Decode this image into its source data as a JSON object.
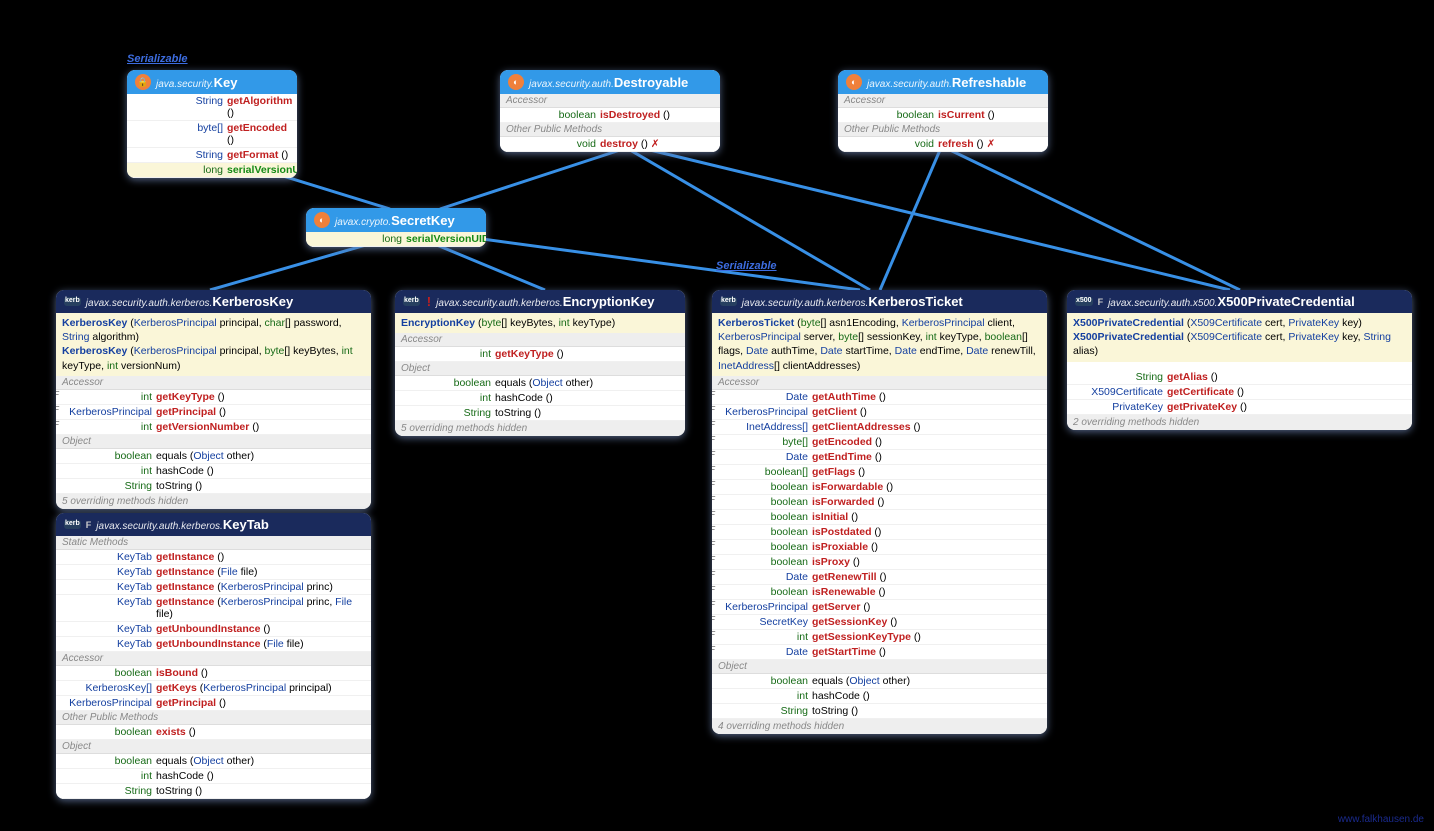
{
  "labels": {
    "serializable": "Serializable",
    "accessor": "Accessor",
    "otherPublic": "Other Public Methods",
    "object": "Object",
    "staticMethods": "Static Methods",
    "watermark": "www.falkhausen.de"
  },
  "key": {
    "pkg": "java.security.",
    "cls": "Key",
    "rows": [
      {
        "ret": "String",
        "name": "getAlgorithm",
        "params": "()"
      },
      {
        "ret": "byte[]",
        "name": "getEncoded",
        "params": "()"
      },
      {
        "ret": "String",
        "name": "getFormat",
        "params": "()"
      }
    ],
    "serial": {
      "ret": "long",
      "name": "serialVersionUID"
    }
  },
  "destroyable": {
    "pkg": "javax.security.auth.",
    "cls": "Destroyable",
    "rows": [
      {
        "ret": "boolean",
        "name": "isDestroyed",
        "params": "()"
      }
    ],
    "other": [
      {
        "ret": "void",
        "name": "destroy",
        "params": "() ",
        "suffix": "✗"
      }
    ]
  },
  "refreshable": {
    "pkg": "javax.security.auth.",
    "cls": "Refreshable",
    "rows": [
      {
        "ret": "boolean",
        "name": "isCurrent",
        "params": "()"
      }
    ],
    "other": [
      {
        "ret": "void",
        "name": "refresh",
        "params": "() ",
        "suffix": "✗"
      }
    ]
  },
  "secretkey": {
    "pkg": "javax.crypto.",
    "cls": "SecretKey",
    "serial": {
      "ret": "long",
      "name": "serialVersionUID"
    }
  },
  "kerbkey": {
    "pkg": "javax.security.auth.kerberos.",
    "cls": "KerberosKey",
    "constructors": [
      "KerberosKey (KerberosPrincipal principal, char[] password, String algorithm)",
      "KerberosKey (KerberosPrincipal principal, byte[] keyBytes, int keyType, int versionNum)"
    ],
    "accessor": [
      {
        "ret": "int",
        "name": "getKeyType",
        "params": "()",
        "flag": "F"
      },
      {
        "ret": "KerberosPrincipal",
        "retBlue": true,
        "name": "getPrincipal",
        "params": "()",
        "flag": "F"
      },
      {
        "ret": "int",
        "name": "getVersionNumber",
        "params": "()",
        "flag": "F"
      }
    ],
    "object": [
      {
        "ret": "boolean",
        "name": "equals",
        "params": "(Object other)",
        "blueName": false,
        "paramBlue": "Object"
      },
      {
        "ret": "int",
        "name": "hashCode",
        "params": "()"
      },
      {
        "ret": "String",
        "name": "toString",
        "params": "()"
      }
    ],
    "hidden": "5 overriding methods hidden"
  },
  "enckey": {
    "pkg": "javax.security.auth.kerberos.",
    "cls": "EncryptionKey",
    "constructors": [
      "EncryptionKey (byte[] keyBytes, int keyType)"
    ],
    "accessor": [
      {
        "ret": "int",
        "name": "getKeyType",
        "params": "()"
      }
    ],
    "object": [
      {
        "ret": "boolean",
        "name": "equals",
        "params": "(Object other)",
        "paramBlue": "Object"
      },
      {
        "ret": "int",
        "name": "hashCode",
        "params": "()"
      },
      {
        "ret": "String",
        "name": "toString",
        "params": "()"
      }
    ],
    "hidden": "5 overriding methods hidden"
  },
  "keytab": {
    "pkg": "javax.security.auth.kerberos.",
    "cls": "KeyTab",
    "static": [
      {
        "ret": "KeyTab",
        "name": "getInstance",
        "params": "()"
      },
      {
        "ret": "KeyTab",
        "name": "getInstance",
        "params": "(File file)",
        "paramBlue": "File"
      },
      {
        "ret": "KeyTab",
        "name": "getInstance",
        "params": "(KerberosPrincipal princ)",
        "paramBlue": "KerberosPrincipal"
      },
      {
        "ret": "KeyTab",
        "name": "getInstance",
        "params": "(KerberosPrincipal princ, File file)",
        "paramBlue": "KerberosPrincipal File"
      },
      {
        "ret": "KeyTab",
        "name": "getUnboundInstance",
        "params": "()"
      },
      {
        "ret": "KeyTab",
        "name": "getUnboundInstance",
        "params": "(File file)",
        "paramBlue": "File"
      }
    ],
    "accessor": [
      {
        "ret": "boolean",
        "name": "isBound",
        "params": "()"
      },
      {
        "ret": "KerberosKey[]",
        "retBlue": true,
        "name": "getKeys",
        "params": "(KerberosPrincipal principal)",
        "paramBlue": "KerberosPrincipal"
      },
      {
        "ret": "KerberosPrincipal",
        "retBlue": true,
        "name": "getPrincipal",
        "params": "()"
      }
    ],
    "other": [
      {
        "ret": "boolean",
        "name": "exists",
        "params": "()"
      }
    ],
    "object": [
      {
        "ret": "boolean",
        "name": "equals",
        "params": "(Object other)",
        "paramBlue": "Object"
      },
      {
        "ret": "int",
        "name": "hashCode",
        "params": "()"
      },
      {
        "ret": "String",
        "name": "toString",
        "params": "()"
      }
    ]
  },
  "ticket": {
    "pkg": "javax.security.auth.kerberos.",
    "cls": "KerberosTicket",
    "constructors": [
      "KerberosTicket (byte[] asn1Encoding, KerberosPrincipal client, KerberosPrincipal server, byte[] sessionKey, int keyType, boolean[] flags, Date authTime, Date startTime, Date endTime, Date renewTill, InetAddress[] clientAddresses)"
    ],
    "accessor": [
      {
        "ret": "Date",
        "retBlue": true,
        "name": "getAuthTime",
        "params": "()",
        "flag": "F"
      },
      {
        "ret": "KerberosPrincipal",
        "retBlue": true,
        "name": "getClient",
        "params": "()",
        "flag": "F"
      },
      {
        "ret": "InetAddress[]",
        "retBlue": true,
        "name": "getClientAddresses",
        "params": "()",
        "flag": "F"
      },
      {
        "ret": "byte[]",
        "name": "getEncoded",
        "params": "()",
        "flag": "F"
      },
      {
        "ret": "Date",
        "retBlue": true,
        "name": "getEndTime",
        "params": "()",
        "flag": "F"
      },
      {
        "ret": "boolean[]",
        "name": "getFlags",
        "params": "()",
        "flag": "F"
      },
      {
        "ret": "boolean",
        "name": "isForwardable",
        "params": "()",
        "flag": "F"
      },
      {
        "ret": "boolean",
        "name": "isForwarded",
        "params": "()",
        "flag": "F"
      },
      {
        "ret": "boolean",
        "name": "isInitial",
        "params": "()",
        "flag": "F"
      },
      {
        "ret": "boolean",
        "name": "isPostdated",
        "params": "()",
        "flag": "F"
      },
      {
        "ret": "boolean",
        "name": "isProxiable",
        "params": "()",
        "flag": "F"
      },
      {
        "ret": "boolean",
        "name": "isProxy",
        "params": "()",
        "flag": "F"
      },
      {
        "ret": "Date",
        "retBlue": true,
        "name": "getRenewTill",
        "params": "()",
        "flag": "F"
      },
      {
        "ret": "boolean",
        "name": "isRenewable",
        "params": "()",
        "flag": "F"
      },
      {
        "ret": "KerberosPrincipal",
        "retBlue": true,
        "name": "getServer",
        "params": "()",
        "flag": "F"
      },
      {
        "ret": "SecretKey",
        "retBlue": true,
        "name": "getSessionKey",
        "params": "()",
        "flag": "F"
      },
      {
        "ret": "int",
        "name": "getSessionKeyType",
        "params": "()",
        "flag": "F"
      },
      {
        "ret": "Date",
        "retBlue": true,
        "name": "getStartTime",
        "params": "()",
        "flag": "F"
      }
    ],
    "object": [
      {
        "ret": "boolean",
        "name": "equals",
        "params": "(Object other)",
        "paramBlue": "Object"
      },
      {
        "ret": "int",
        "name": "hashCode",
        "params": "()"
      },
      {
        "ret": "String",
        "name": "toString",
        "params": "()"
      }
    ],
    "hidden": "4 overriding methods hidden"
  },
  "x500": {
    "pkg": "javax.security.auth.x500.",
    "cls": "X500PrivateCredential",
    "constructors": [
      "X500PrivateCredential (X509Certificate cert, PrivateKey key)",
      "X500PrivateCredential (X509Certificate cert, PrivateKey key, String alias)"
    ],
    "accessor": [
      {
        "ret": "String",
        "name": "getAlias",
        "params": "()"
      },
      {
        "ret": "X509Certificate",
        "retBlue": true,
        "name": "getCertificate",
        "params": "()"
      },
      {
        "ret": "PrivateKey",
        "retBlue": true,
        "name": "getPrivateKey",
        "params": "()"
      }
    ],
    "hidden": "2 overriding methods hidden"
  }
}
